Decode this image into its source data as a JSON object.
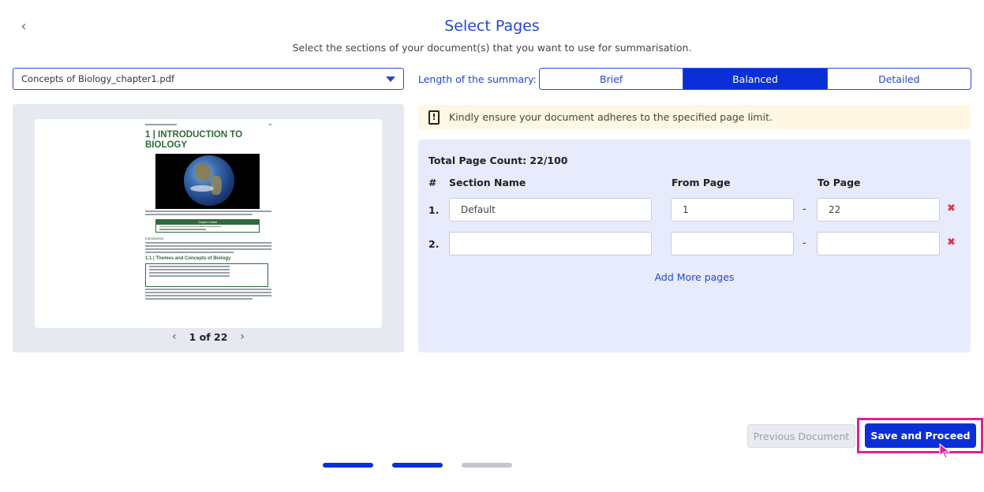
{
  "header": {
    "back_icon": "chevron-left-icon",
    "title": "Select Pages",
    "subtitle": "Select the sections of your document(s) that you want to use for summarisation."
  },
  "document_select": {
    "value": "Concepts of Biology_chapter1.pdf"
  },
  "summary_length": {
    "label": "Length of the summary:",
    "options": [
      "Brief",
      "Balanced",
      "Detailed"
    ],
    "selected": "Balanced"
  },
  "preview": {
    "doc_title": "1 | INTRODUCTION TO BIOLOGY",
    "outline_header": "Chapter Outline",
    "section_heading": "1.1 | Themes and Concepts of Biology",
    "sub_heading": "Introduction",
    "pager": {
      "current": 1,
      "total": 22,
      "label": "1 of 22"
    }
  },
  "notice": {
    "icon": "warning-icon",
    "text": "Kindly ensure your document adheres to the specified page limit."
  },
  "sections": {
    "total_label": "Total Page Count: 22/100",
    "columns": {
      "num": "#",
      "name": "Section Name",
      "from": "From Page",
      "to": "To Page"
    },
    "rows": [
      {
        "num": "1.",
        "name": "Default",
        "from": "1",
        "to": "22"
      },
      {
        "num": "2.",
        "name": "",
        "from": "",
        "to": ""
      }
    ],
    "add_more": "Add More pages"
  },
  "footer": {
    "prev_label": "Previous Document",
    "save_label": "Save and Proceed",
    "steps": [
      "done",
      "done",
      "todo"
    ]
  },
  "colors": {
    "accent": "#0a2fd8",
    "highlight": "#e0209a",
    "delete": "#e0304a",
    "doc_green": "#2e6b3a"
  }
}
